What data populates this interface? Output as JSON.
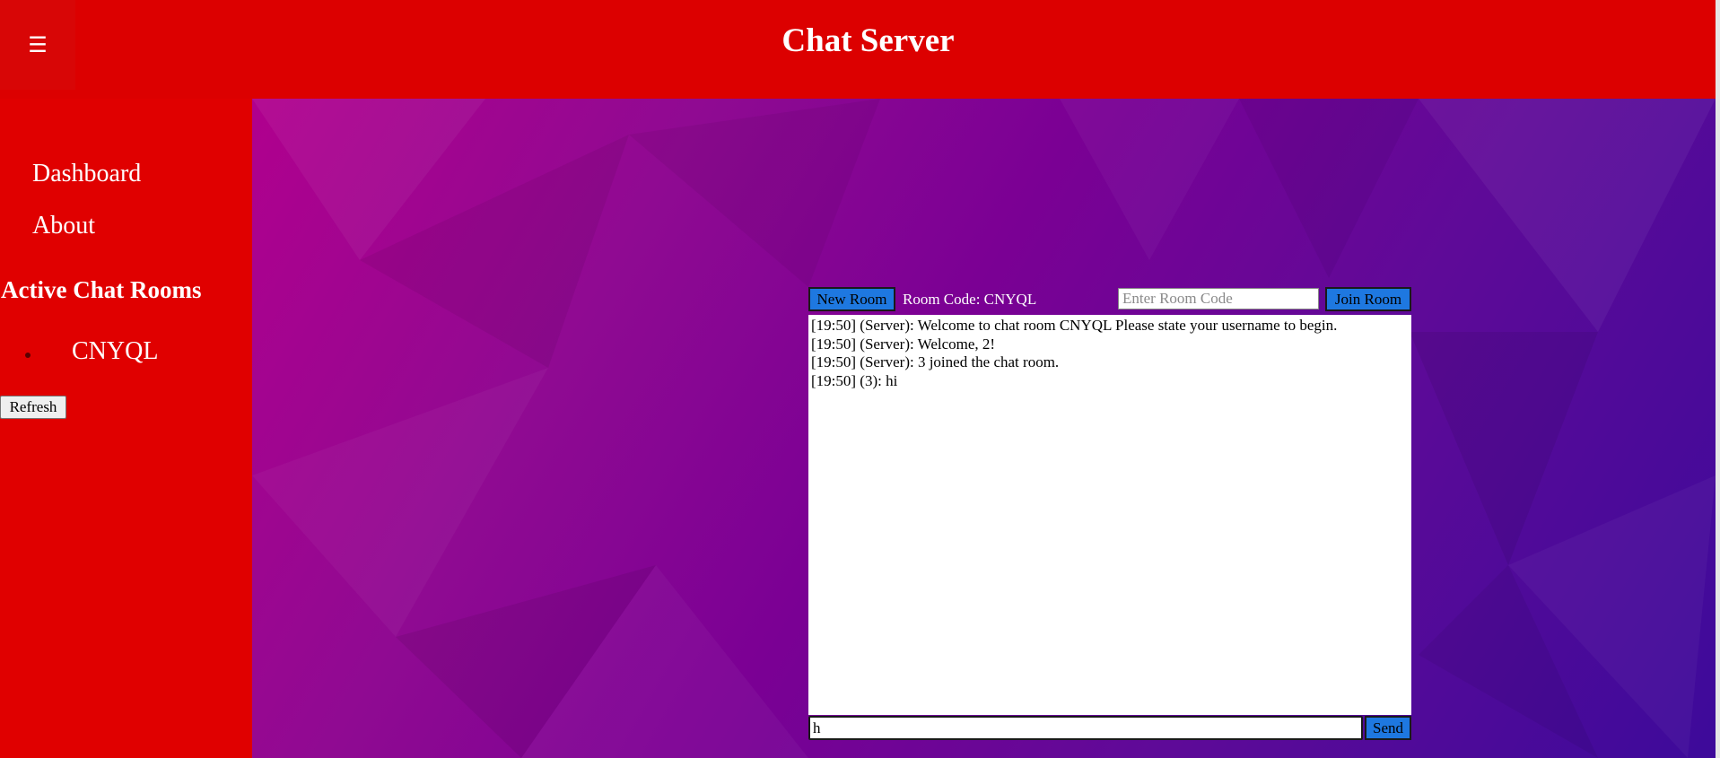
{
  "header": {
    "menu_icon": "☰",
    "title": "Chat Server"
  },
  "sidebar": {
    "items": [
      {
        "label": "Dashboard"
      },
      {
        "label": "About"
      }
    ],
    "rooms_heading": "Active Chat Rooms",
    "rooms": [
      {
        "code": "CNYQL"
      }
    ],
    "refresh_label": "Refresh"
  },
  "chat": {
    "new_room_label": "New Room",
    "room_code_text": "Room Code: CNYQL",
    "room_code_placeholder": "Enter Room Code",
    "join_room_label": "Join Room",
    "messages": [
      {
        "text": "[19:50] (Server): Welcome to chat room CNYQL Please state your username to begin."
      },
      {
        "text": "[19:50] (Server): Welcome, 2!"
      },
      {
        "text": "[19:50] (Server): 3 joined the chat room."
      },
      {
        "text": "[19:50] (3): hi"
      }
    ],
    "input_value": "h",
    "send_label": "Send"
  },
  "colors": {
    "header_bg": "#dc0000",
    "sidebar_bg": "#e00000",
    "button_blue": "#1e78e0",
    "main_gradient_start": "#b0008e",
    "main_gradient_end": "#3d0a9a"
  }
}
